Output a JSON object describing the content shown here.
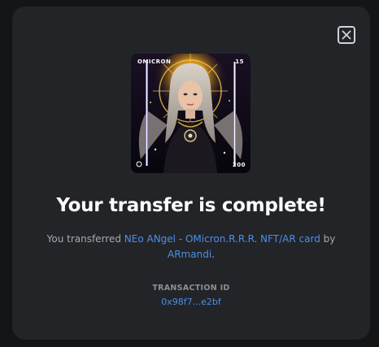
{
  "modal": {
    "close_icon": "close-icon",
    "nft": {
      "icon": "nft-artwork",
      "tag_top_left": "OMICRON",
      "tag_top_right": "15",
      "tag_bottom_right": "200"
    },
    "headline": "Your transfer is complete!",
    "message": {
      "prefix": "You transferred ",
      "nft_name": "NEo ANgel - OMicron.R.R.R. NFT/AR card",
      "connector": " by ",
      "creator": "ARmandi",
      "suffix": "."
    },
    "transaction": {
      "label": "TRANSACTION ID",
      "id": "0x98f7...e2bf"
    }
  },
  "colors": {
    "background": "#141517",
    "modal": "#232428",
    "link": "#4a8fe7",
    "headline": "#ffffff",
    "muted": "#a6a9ae"
  }
}
